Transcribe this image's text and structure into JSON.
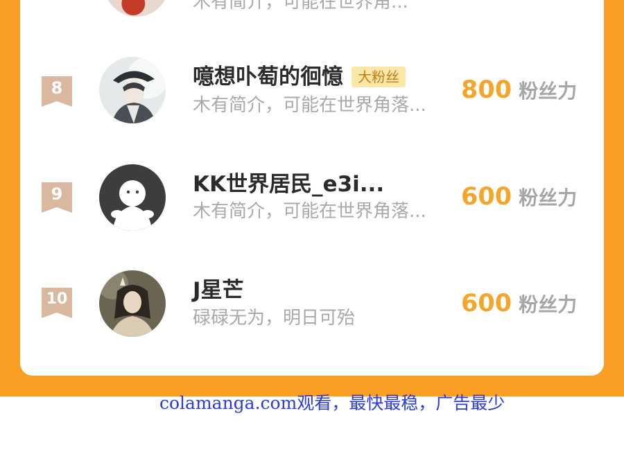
{
  "partial_row": {
    "bio": "木有简介，可能在世界角..."
  },
  "ranking": [
    {
      "rank": "8",
      "name": "噫想卟萄的徊憶",
      "tag": "大粉丝",
      "bio": "木有简介，可能在世界角落...",
      "score": "800",
      "score_unit": "粉丝力",
      "avatar_icon": "anime-character-avatar"
    },
    {
      "rank": "9",
      "name": "KK世界居民_e3i...",
      "tag": "",
      "bio": "木有简介，可能在世界角落...",
      "score": "600",
      "score_unit": "粉丝力",
      "avatar_icon": "default-user-avatar"
    },
    {
      "rank": "10",
      "name": "J星芒",
      "tag": "",
      "bio": "碌碌无为，明日可殆",
      "score": "600",
      "score_unit": "粉丝力",
      "avatar_icon": "anime-character-avatar"
    }
  ],
  "footer": {
    "ad_text": "colamanga.com观看，最快最稳，广告最少"
  },
  "colors": {
    "background_accent": "#fb9f24",
    "rank_badge": "#d9b89f",
    "score": "#f4a62a",
    "tag_bg": "#fbe7a7",
    "ad_link": "#2a3bd6"
  }
}
